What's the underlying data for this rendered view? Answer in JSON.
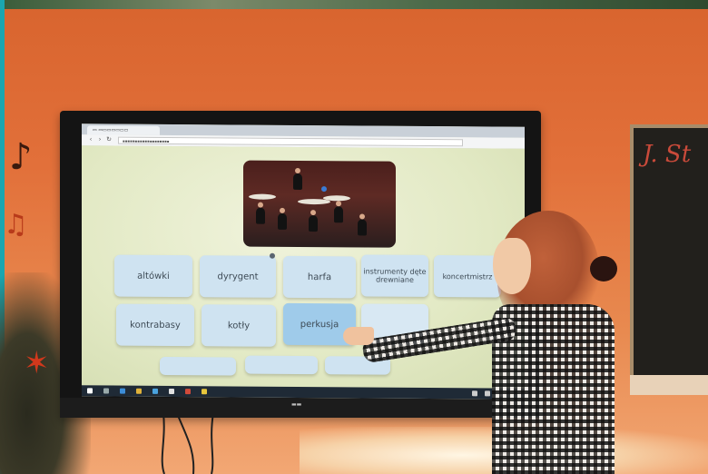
{
  "tiles": [
    {
      "label": "altówki"
    },
    {
      "label": "dyrygent"
    },
    {
      "label": "harfa"
    },
    {
      "label": "instrumenty dęte drewniane"
    },
    {
      "label": "koncertmistrz"
    },
    {
      "label": "kontrabasy"
    },
    {
      "label": "kotły"
    },
    {
      "label": "perkusja"
    }
  ],
  "colors": {
    "wall": "#e2703a",
    "tile": "#cfe3f1",
    "tile_selected": "#9fcbea",
    "app_background": "#e6ebc8"
  },
  "icons": {
    "note": "♪",
    "angel": "♠"
  }
}
